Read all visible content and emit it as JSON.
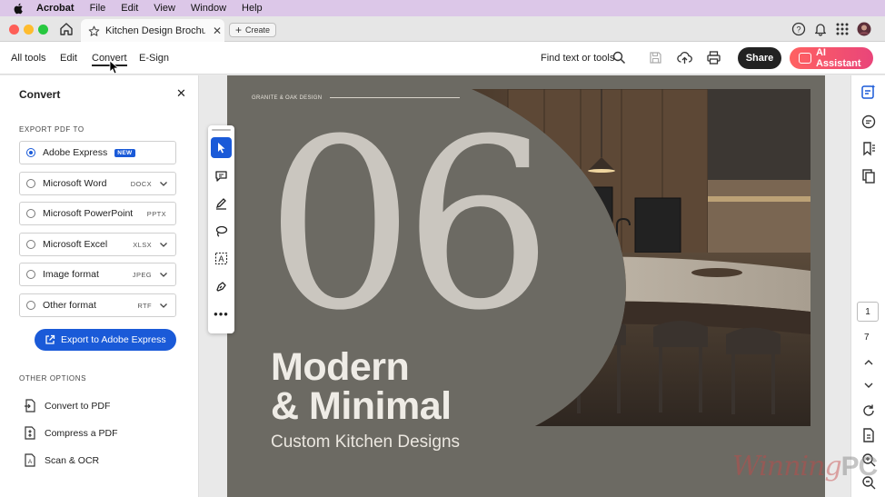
{
  "menubar": {
    "app": "Acrobat",
    "items": [
      "File",
      "Edit",
      "View",
      "Window",
      "Help"
    ]
  },
  "tabbar": {
    "doc_title": "Kitchen Design Brochu...",
    "create_label": "Create"
  },
  "toolbar": {
    "tabs": [
      "All tools",
      "Edit",
      "Convert",
      "E-Sign"
    ],
    "active_tab": "Convert",
    "find_label": "Find text or tools",
    "share_label": "Share",
    "ai_label": "AI Assistant"
  },
  "panel": {
    "title": "Convert",
    "export_heading": "EXPORT PDF TO",
    "options": [
      {
        "label": "Adobe Express",
        "badge": "NEW",
        "selected": true
      },
      {
        "label": "Microsoft Word",
        "ext": "DOCX"
      },
      {
        "label": "Microsoft PowerPoint",
        "ext": "PPTX"
      },
      {
        "label": "Microsoft Excel",
        "ext": "XLSX"
      },
      {
        "label": "Image format",
        "ext": "JPEG"
      },
      {
        "label": "Other format",
        "ext": "RTF"
      }
    ],
    "export_button": "Export to Adobe Express",
    "other_heading": "OTHER OPTIONS",
    "other_options": [
      "Convert to PDF",
      "Compress a PDF",
      "Scan & OCR"
    ]
  },
  "document": {
    "brand": "GRANITE & OAK DESIGN",
    "big_number": "06",
    "headline_1": "Modern",
    "headline_2": "& Minimal",
    "subline": "Custom Kitchen Designs"
  },
  "pagination": {
    "current": "1",
    "total": "7"
  },
  "watermark": {
    "word": "Winning",
    "suffix": "PC"
  },
  "colors": {
    "accent": "#1a5ad8",
    "ai_gradient_start": "#ff6161",
    "ai_gradient_end": "#e9457a",
    "page_bg": "#6c6a63"
  }
}
